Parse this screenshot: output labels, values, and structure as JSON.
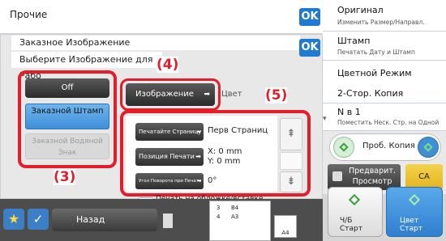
{
  "header": {
    "title": "Прочие",
    "ok": "OK"
  },
  "dialog": {
    "title": "Заказное Изображение",
    "subtitle": "Выберите Изображение для Рабо",
    "ok": "OK"
  },
  "options": {
    "off": "Off",
    "custom_stamp": "Заказной Штамп",
    "custom_watermark": "Заказной Водяной Знак"
  },
  "image_button": {
    "label": "Изображение",
    "suffix": "Цвет"
  },
  "settings": {
    "print_page_btn": "Печатайте Страницу",
    "print_page_value": "Перв Страниц",
    "print_pos_btn": "Позиция Печати",
    "pos_x": "X: 0 mm",
    "pos_y": "Y: 0 mm",
    "rotation_btn": "Угол Поворота при Печати",
    "rotation_value": "0°",
    "cover_check": "Печать на обложке/вставке при копировании на обложке/вставке"
  },
  "callouts": {
    "c3": "(3)",
    "c4": "(4)",
    "c5": "(5)"
  },
  "right": {
    "original": "Оригинал",
    "original_sub": "Изменить Размер/Направл.",
    "stamp": "Штамп",
    "stamp_sub": "Печатать Дату и Штамп",
    "color": "Цветной Режим",
    "duplex": "2-Стор. Копия",
    "nin1": "N в 1",
    "nin1_sub": "Поместить Неск. Стр. на Одной",
    "preview_copy": "Проб. Копия",
    "preview": "Предварит. Просмотр",
    "ca": "CA",
    "bw_start": "Ч/Б Старт",
    "color_start": "Цвет Старт"
  },
  "bottom": {
    "back": "Назад",
    "tray3": "3",
    "tray4": "4",
    "size_b4": "B4",
    "size_a3": "A3",
    "size_a4": "A4"
  }
}
